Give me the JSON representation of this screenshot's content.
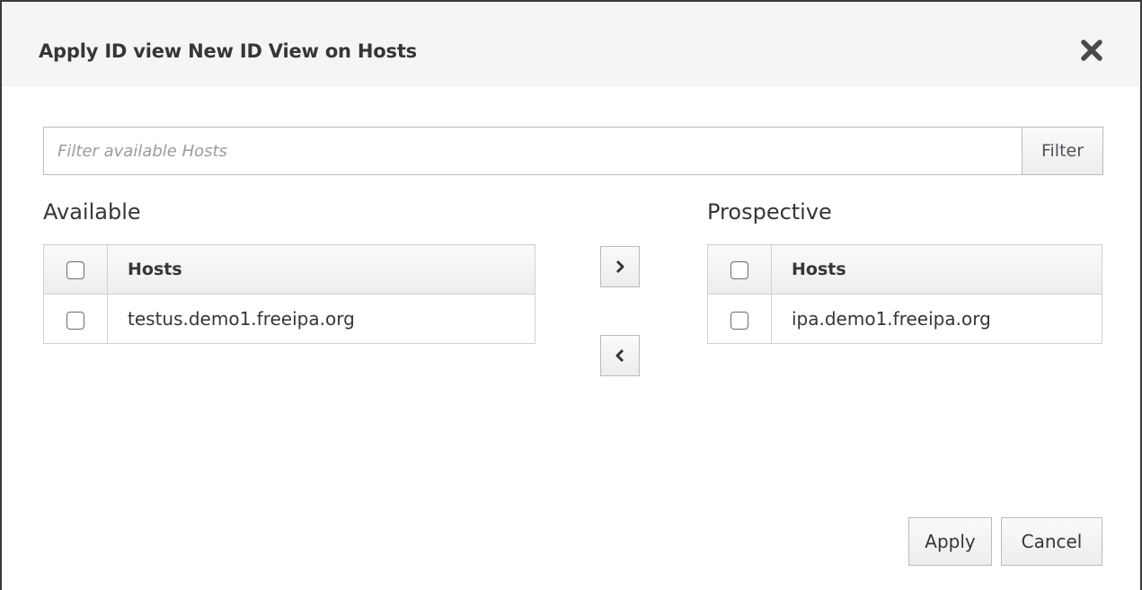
{
  "dialog": {
    "title": "Apply ID view New ID View on Hosts",
    "close_icon": "close-icon"
  },
  "filter": {
    "placeholder": "Filter available Hosts",
    "value": "",
    "button_label": "Filter"
  },
  "available": {
    "label": "Available",
    "column_header": "Hosts",
    "rows": [
      {
        "host": "testus.demo1.freeipa.org",
        "checked": false
      }
    ]
  },
  "prospective": {
    "label": "Prospective",
    "column_header": "Hosts",
    "rows": [
      {
        "host": "ipa.demo1.freeipa.org",
        "checked": false
      }
    ]
  },
  "move": {
    "add_icon": "chevron-right-icon",
    "remove_icon": "chevron-left-icon"
  },
  "footer": {
    "apply_label": "Apply",
    "cancel_label": "Cancel"
  },
  "colors": {
    "header_bg": "#f5f5f5",
    "border": "#bbbbbb",
    "text": "#363636",
    "placeholder": "#9c9c9c"
  }
}
